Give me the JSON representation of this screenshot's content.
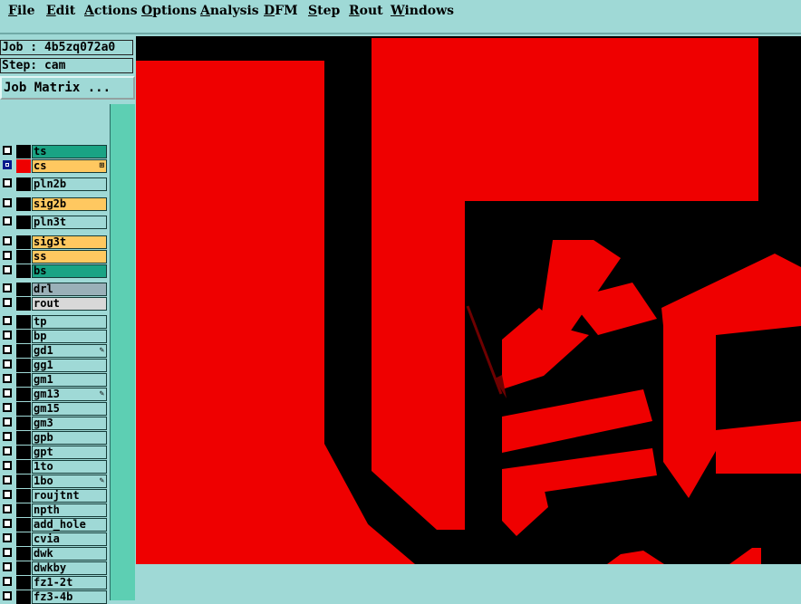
{
  "menubar": {
    "items": [
      {
        "label": "File",
        "ul": "F",
        "rest": "ile"
      },
      {
        "label": "Edit",
        "ul": "E",
        "rest": "dit"
      },
      {
        "label": "Actions",
        "ul": "A",
        "rest": "ctions"
      },
      {
        "label": "Options",
        "ul": "O",
        "rest": "ptions"
      },
      {
        "label": "Analysis",
        "ul": "A",
        "rest": "nalysis"
      },
      {
        "label": "DFM",
        "ul": "D",
        "rest": "FM"
      },
      {
        "label": "Step",
        "ul": "S",
        "rest": "tep"
      },
      {
        "label": "Rout",
        "ul": "R",
        "rest": "out"
      },
      {
        "label": "Windows",
        "ul": "W",
        "rest": "indows"
      }
    ]
  },
  "job_info": {
    "job_label": "Job : 4b5zq072a0",
    "step_label": "Step: cam",
    "job_matrix_button": "Job Matrix ..."
  },
  "layers": [
    {
      "name": "ts",
      "color": "#1aa384",
      "active": false,
      "swatch": "black",
      "mark": ""
    },
    {
      "name": "cs",
      "color": "#ffc860",
      "active": true,
      "swatch": "red",
      "mark": "⊞"
    },
    {
      "name": "pln2b",
      "color": "#9fd9d6",
      "active": false,
      "swatch": "black",
      "mark": ""
    },
    {
      "name": "sig2b",
      "color": "#ffc860",
      "active": false,
      "swatch": "black",
      "mark": ""
    },
    {
      "name": "pln3t",
      "color": "#9fd9d6",
      "active": false,
      "swatch": "black",
      "mark": ""
    },
    {
      "name": "sig3t",
      "color": "#ffc860",
      "active": false,
      "swatch": "black",
      "mark": ""
    },
    {
      "name": "ss",
      "color": "#ffc860",
      "active": false,
      "swatch": "black",
      "mark": ""
    },
    {
      "name": "bs",
      "color": "#1aa384",
      "active": false,
      "swatch": "black",
      "mark": ""
    },
    {
      "name": "drl",
      "color": "#9ab0b8",
      "active": false,
      "swatch": "black",
      "mark": ""
    },
    {
      "name": "rout",
      "color": "#d8d8d8",
      "active": false,
      "swatch": "black",
      "mark": ""
    },
    {
      "name": "tp",
      "color": "#9fd9d6",
      "active": false,
      "swatch": "black",
      "mark": ""
    },
    {
      "name": "bp",
      "color": "#9fd9d6",
      "active": false,
      "swatch": "black",
      "mark": ""
    },
    {
      "name": "gd1",
      "color": "#9fd9d6",
      "active": false,
      "swatch": "black",
      "mark": "✎"
    },
    {
      "name": "gg1",
      "color": "#9fd9d6",
      "active": false,
      "swatch": "black",
      "mark": ""
    },
    {
      "name": "gm1",
      "color": "#9fd9d6",
      "active": false,
      "swatch": "black",
      "mark": ""
    },
    {
      "name": "gm13",
      "color": "#9fd9d6",
      "active": false,
      "swatch": "black",
      "mark": "✎"
    },
    {
      "name": "gm15",
      "color": "#9fd9d6",
      "active": false,
      "swatch": "black",
      "mark": ""
    },
    {
      "name": "gm3",
      "color": "#9fd9d6",
      "active": false,
      "swatch": "black",
      "mark": ""
    },
    {
      "name": "gpb",
      "color": "#9fd9d6",
      "active": false,
      "swatch": "black",
      "mark": ""
    },
    {
      "name": "gpt",
      "color": "#9fd9d6",
      "active": false,
      "swatch": "black",
      "mark": ""
    },
    {
      "name": "1to",
      "color": "#9fd9d6",
      "active": false,
      "swatch": "black",
      "mark": ""
    },
    {
      "name": "1bo",
      "color": "#9fd9d6",
      "active": false,
      "swatch": "black",
      "mark": "✎"
    },
    {
      "name": "roujtnt",
      "color": "#9fd9d6",
      "active": false,
      "swatch": "black",
      "mark": ""
    },
    {
      "name": "npth",
      "color": "#9fd9d6",
      "active": false,
      "swatch": "black",
      "mark": ""
    },
    {
      "name": "add_hole",
      "color": "#9fd9d6",
      "active": false,
      "swatch": "black",
      "mark": ""
    },
    {
      "name": "cvia",
      "color": "#9fd9d6",
      "active": false,
      "swatch": "black",
      "mark": ""
    },
    {
      "name": "dwk",
      "color": "#9fd9d6",
      "active": false,
      "swatch": "black",
      "mark": ""
    },
    {
      "name": "dwkby",
      "color": "#9fd9d6",
      "active": false,
      "swatch": "black",
      "mark": ""
    },
    {
      "name": "fz1-2t",
      "color": "#9fd9d6",
      "active": false,
      "swatch": "black",
      "mark": ""
    },
    {
      "name": "fz3-4b",
      "color": "#9fd9d6",
      "active": false,
      "swatch": "black",
      "mark": ""
    }
  ],
  "canvas": {
    "background": "#000000",
    "feature_color": "#ef0000",
    "arrow_color": "#6e0000",
    "glyph_text": "红"
  }
}
